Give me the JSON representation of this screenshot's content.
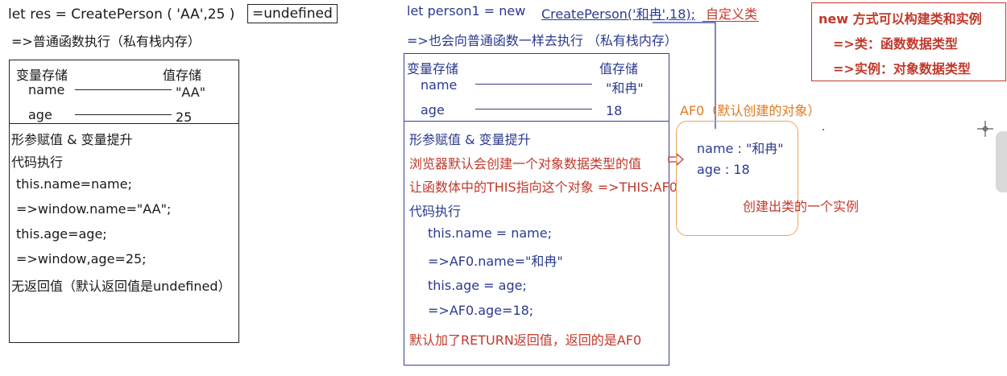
{
  "left": {
    "line1_code": "let res =   CreatePerson ( 'AA',25 )",
    "line1_result": "=undefined",
    "line2": "=>普通函数执行（私有栈内存）",
    "table_hdr_var": "变量存储",
    "table_hdr_val": "值存储",
    "var_name": "name",
    "val_name": "\"AA\"",
    "var_age": "age",
    "val_age": "25",
    "steps": [
      "形参赋值 & 变量提升",
      "代码执行",
      " this.name=name;",
      " =>window.name=\"AA\";",
      " this.age=age;",
      " =>window,age=25;",
      "无返回值（默认返回值是undefined）"
    ]
  },
  "mid": {
    "line1_code": "let person1 = new ",
    "line1_call": "CreatePerson('和冉',18);",
    "line1_note": "自定义类",
    "line2": "=>也会向普通函数一样去执行 （私有栈内存）",
    "table_hdr_var": "变量存储",
    "table_hdr_val": "值存储",
    "var_name": "name",
    "val_name": "\"和冉\"",
    "var_age": "age",
    "val_age": "18",
    "step_hoist": "形参赋值 & 变量提升",
    "step_create": "浏览器默认会创建一个对象数据类型的值",
    "step_this": "让函数体中的THIS指向这个对象 =>THIS:AF0",
    "step_exec": "代码执行",
    "code_lines": [
      "this.name = name;",
      "=>AF0.name=\"和冉\"",
      "this.age = age;",
      "=>AF0.age=18;"
    ],
    "step_return": "默认加了RETURN返回值，返回的是AF0"
  },
  "object": {
    "label": "AF0（默认创建的对象）",
    "prop_name": "name : \"和冉\"",
    "prop_age": "age : 18",
    "note": "创建出类的一个实例"
  },
  "notebox": {
    "line1": "new 方式可以构建类和实例",
    "line2": "=>类：函数数据类型",
    "line3": "=>实例：对象数据类型"
  },
  "colors": {
    "blue": "#2b3a8f",
    "red": "#c0392b",
    "orange": "#e07a1f"
  }
}
